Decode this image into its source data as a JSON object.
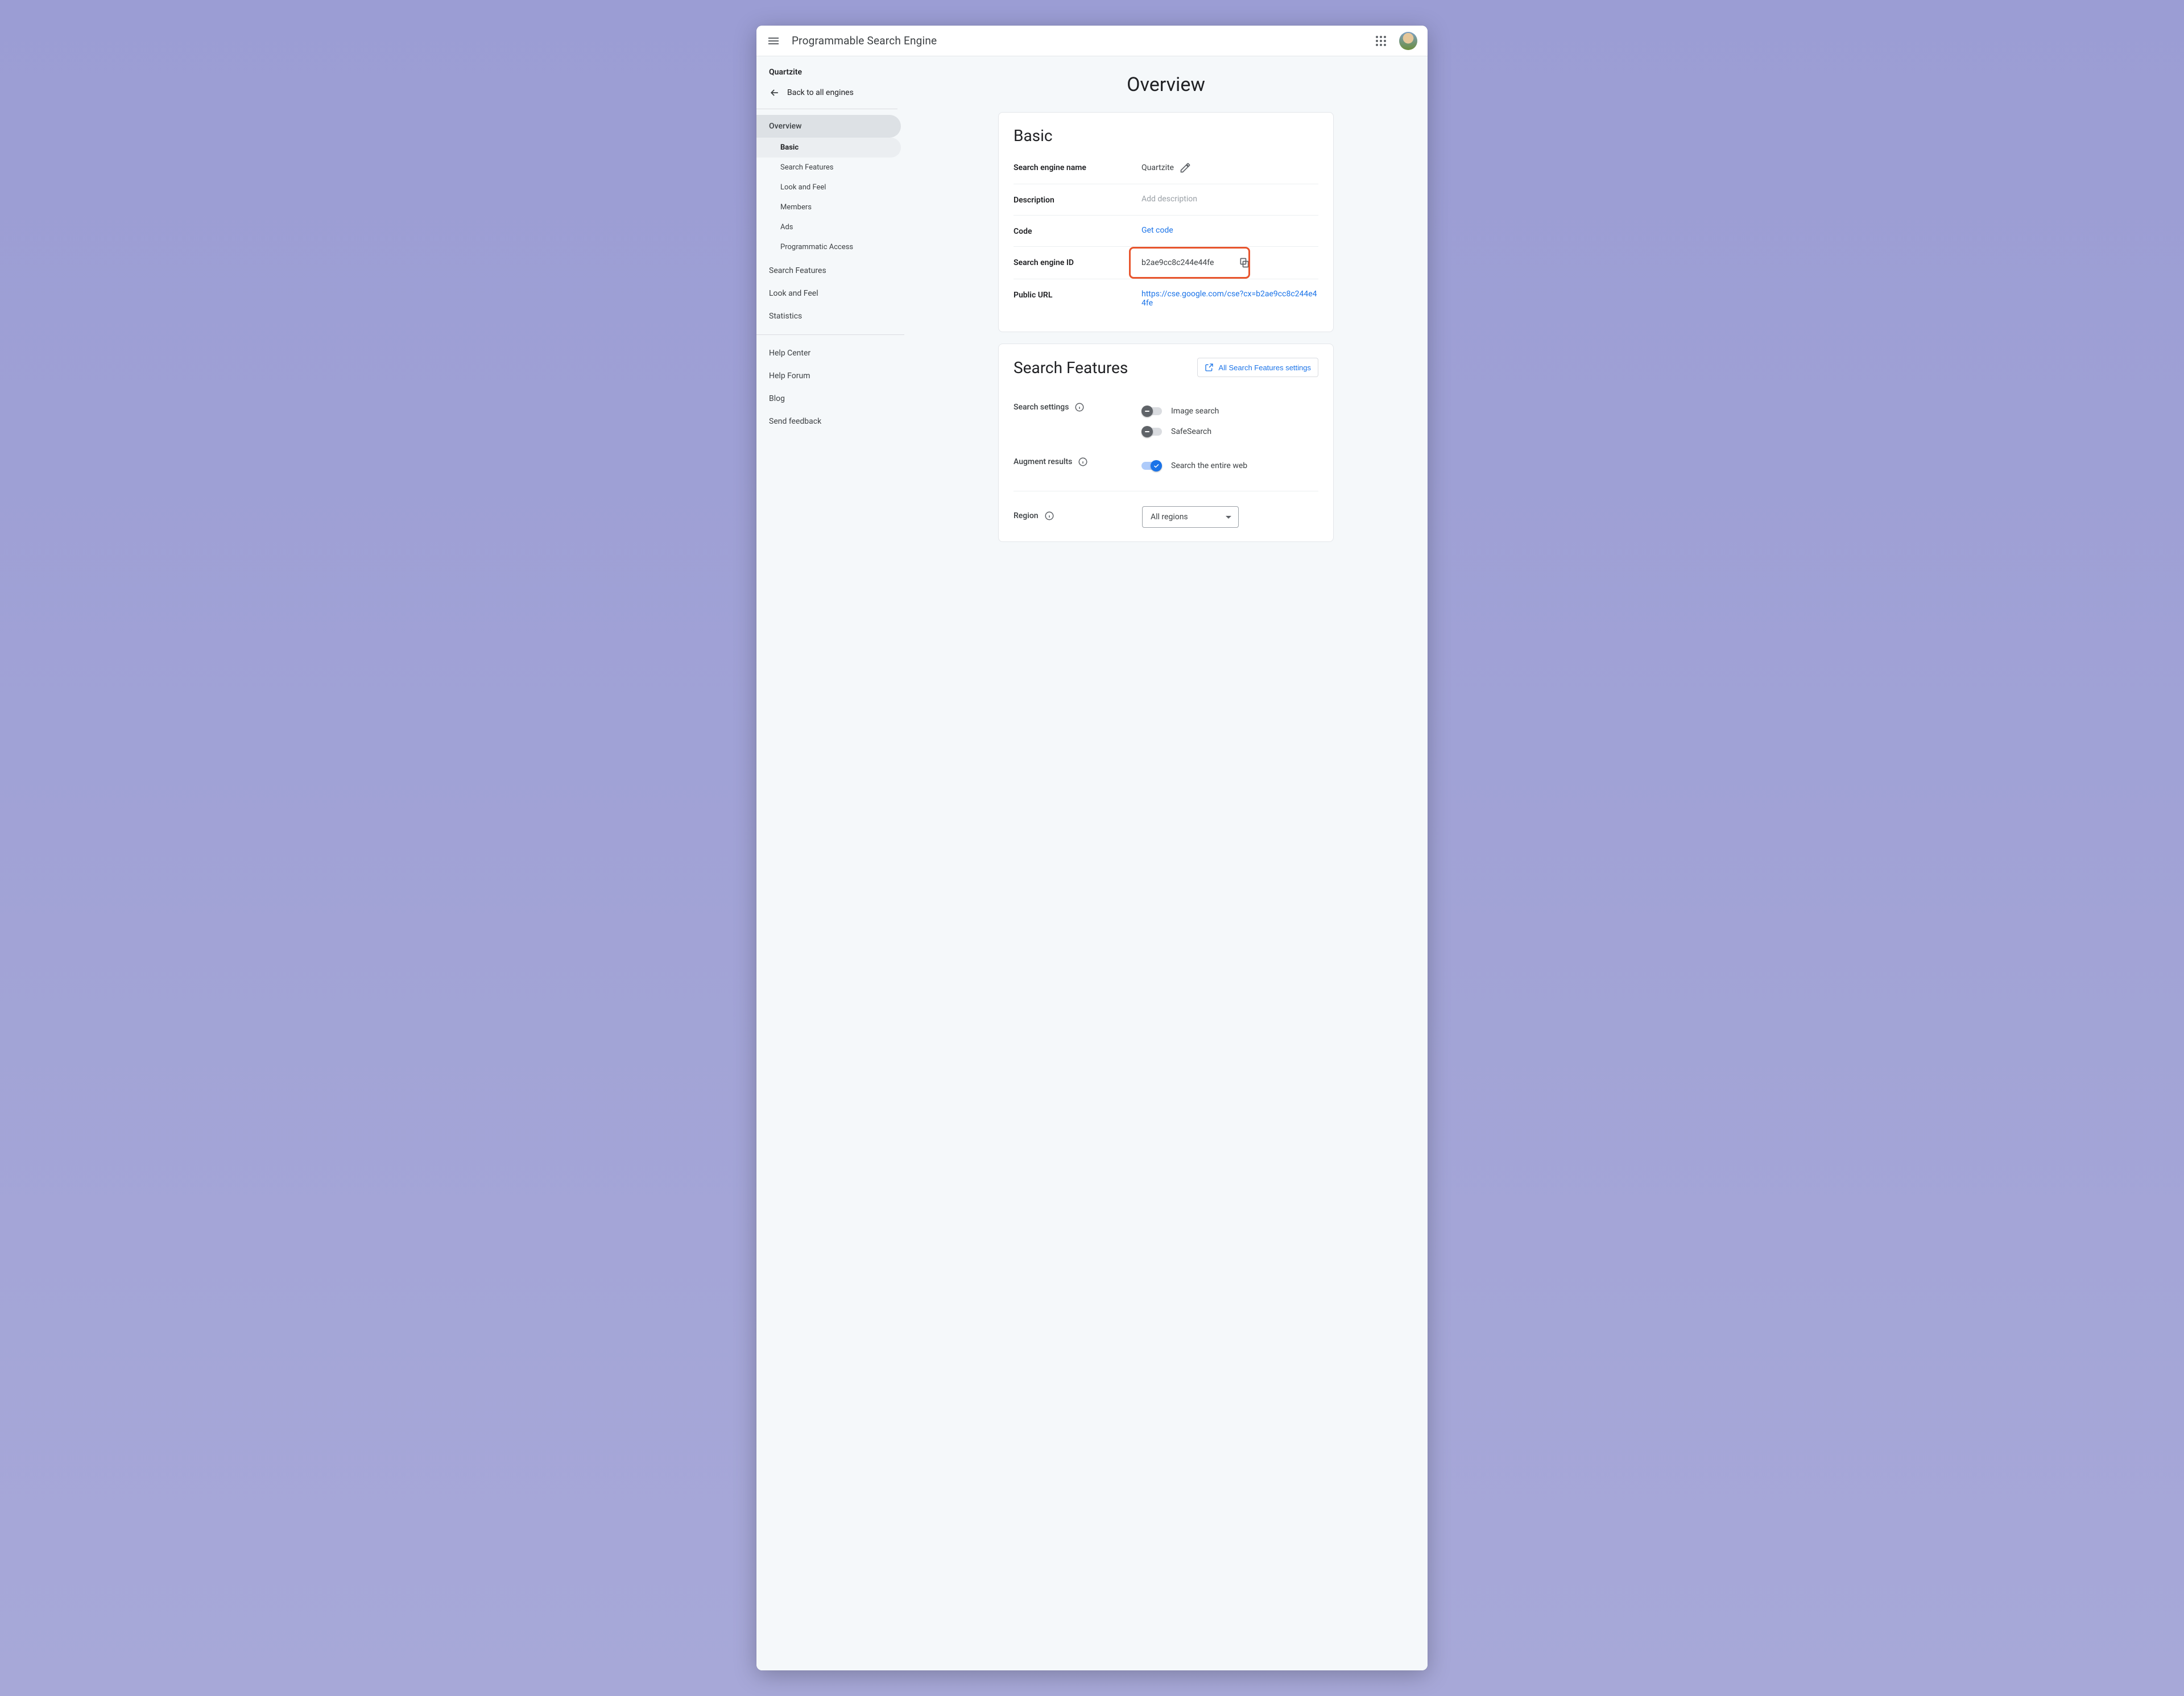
{
  "header": {
    "app_title": "Programmable Search Engine"
  },
  "sidebar": {
    "engine_name": "Quartzite",
    "back_label": "Back to all engines",
    "nav_overview": "Overview",
    "nav_overview_subs": {
      "basic": "Basic",
      "search_feat": "Search Features",
      "look_feel": "Look and Feel",
      "members": "Members",
      "ads": "Ads",
      "prog": "Programmatic Access"
    },
    "nav_search_features": "Search Features",
    "nav_look_feel": "Look and Feel",
    "nav_stats": "Statistics",
    "help_center": "Help Center",
    "help_forum": "Help Forum",
    "blog": "Blog",
    "send_feedback": "Send feedback"
  },
  "page": {
    "title": "Overview"
  },
  "basic": {
    "card_title": "Basic",
    "rows": {
      "name_label": "Search engine name",
      "name_value": "Quartzite",
      "desc_label": "Description",
      "desc_placeholder": "Add description",
      "code_label": "Code",
      "code_link": "Get code",
      "id_label": "Search engine ID",
      "id_value": "b2ae9cc8c244e44fe",
      "url_label": "Public URL",
      "url_value": "https://cse.google.com/cse?cx=b2ae9cc8c244e44fe"
    }
  },
  "search_features": {
    "card_title": "Search Features",
    "all_settings_btn": "All Search Features settings",
    "settings_label": "Search settings",
    "augment_label": "Augment results",
    "toggles": {
      "image": "Image search",
      "safe": "SafeSearch",
      "entire_web": "Search the entire web"
    },
    "region_label": "Region",
    "region_value": "All regions"
  }
}
